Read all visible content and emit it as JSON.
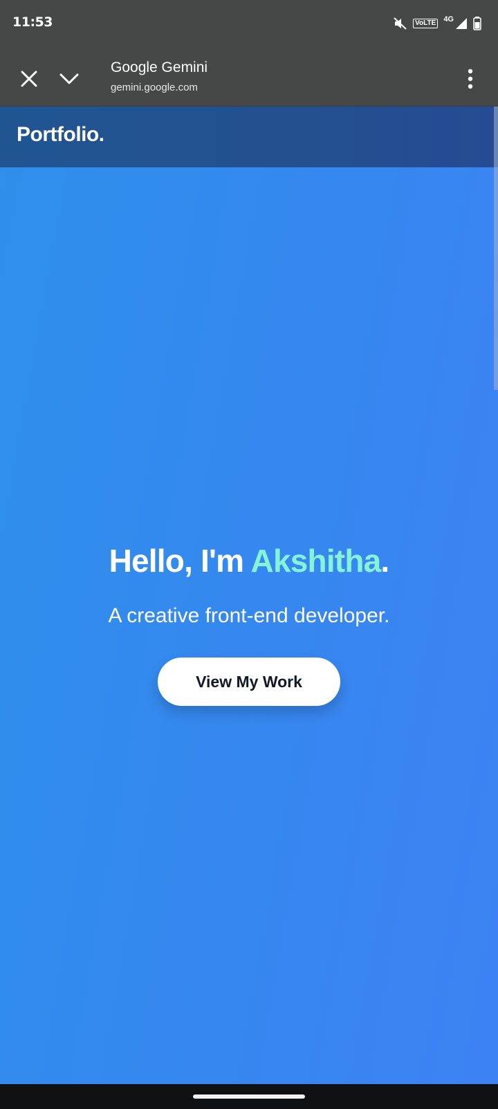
{
  "status_bar": {
    "time": "11:53",
    "volte_label": "VoLTE",
    "network_label": "4G",
    "icons": [
      "mute-icon",
      "volte-icon",
      "signal-icon",
      "battery-icon"
    ]
  },
  "browser_tab": {
    "title": "Google Gemini",
    "url": "gemini.google.com",
    "icons": [
      "close-icon",
      "chevron-down-icon",
      "more-vert-icon"
    ]
  },
  "site": {
    "logo": "Portfolio.",
    "hero": {
      "greeting": "Hello, I'm ",
      "name": "Akshitha",
      "punctuation": ".",
      "subtitle": "A creative front-end developer.",
      "cta_label": "View My Work"
    }
  },
  "colors": {
    "accent_name": "#86f3d6",
    "hero_bg_start": "#2f8feb",
    "hero_bg_end": "#3d82f5",
    "header_bg": "#23508f",
    "chrome_bar": "#464747"
  }
}
